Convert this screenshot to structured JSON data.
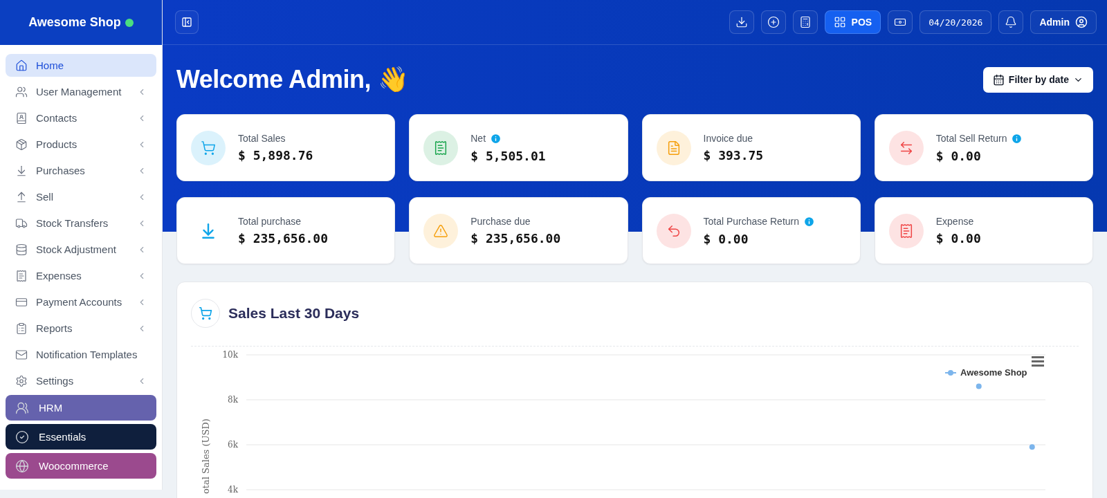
{
  "brand": {
    "name": "Awesome Shop",
    "online": true
  },
  "sidebar": {
    "items": [
      {
        "label": "Home",
        "selected": true,
        "submenu": false
      },
      {
        "label": "User Management",
        "selected": false,
        "submenu": true
      },
      {
        "label": "Contacts",
        "selected": false,
        "submenu": true
      },
      {
        "label": "Products",
        "selected": false,
        "submenu": true
      },
      {
        "label": "Purchases",
        "selected": false,
        "submenu": true
      },
      {
        "label": "Sell",
        "selected": false,
        "submenu": true
      },
      {
        "label": "Stock Transfers",
        "selected": false,
        "submenu": true
      },
      {
        "label": "Stock Adjustment",
        "selected": false,
        "submenu": true
      },
      {
        "label": "Expenses",
        "selected": false,
        "submenu": true
      },
      {
        "label": "Payment Accounts",
        "selected": false,
        "submenu": true
      },
      {
        "label": "Reports",
        "selected": false,
        "submenu": true
      },
      {
        "label": "Notification Templates",
        "selected": false,
        "submenu": false
      },
      {
        "label": "Settings",
        "selected": false,
        "submenu": true
      }
    ],
    "modules": [
      {
        "label": "HRM",
        "color": "#6562ad"
      },
      {
        "label": "Essentials",
        "color": "#0f1f3d"
      },
      {
        "label": "Woocommerce",
        "color": "#9b4a8e"
      }
    ]
  },
  "topbar": {
    "buttons": [
      {
        "kind": "icon"
      },
      {
        "kind": "icon"
      },
      {
        "kind": "icon"
      },
      {
        "kind": "pos",
        "label": "POS"
      },
      {
        "kind": "icon"
      },
      {
        "kind": "date",
        "label": "04/20/2026"
      },
      {
        "kind": "icon"
      },
      {
        "kind": "user",
        "label": "Admin"
      }
    ]
  },
  "welcome": {
    "title": "Welcome Admin,",
    "emoji": "👋",
    "filter": "Filter by date"
  },
  "stats": [
    {
      "label": "Total Sales",
      "value": "$ 5,898.76",
      "color": "#0ea5e9",
      "info": false
    },
    {
      "label": "Net",
      "value": "$ 5,505.01",
      "color": "#16a34a",
      "info": true
    },
    {
      "label": "Invoice due",
      "value": "$ 393.75",
      "color": "#f59e0b",
      "info": false
    },
    {
      "label": "Total Sell Return",
      "value": "$ 0.00",
      "color": "#ef4444",
      "info": true
    },
    {
      "label": "Total purchase",
      "value": "$ 235,656.00",
      "color": "#0ea5e9",
      "info": false
    },
    {
      "label": "Purchase due",
      "value": "$ 235,656.00",
      "color": "#f59e0b",
      "info": false
    },
    {
      "label": "Total Purchase Return",
      "value": "$ 0.00",
      "color": "#ef4444",
      "info": true
    },
    {
      "label": "Expense",
      "value": "$ 0.00",
      "color": "#ef4444",
      "info": false
    }
  ],
  "sales_panel": {
    "title": "Sales Last 30 Days",
    "chart_data": {
      "type": "line",
      "ylabel": "otal Sales (USD)",
      "grid": true,
      "ylim": [
        4000,
        10000
      ],
      "yticks": [
        {
          "value": 4000,
          "label": "4k"
        },
        {
          "value": 6000,
          "label": "6k"
        },
        {
          "value": 8000,
          "label": "8k"
        },
        {
          "value": 10000,
          "label": "10k"
        }
      ],
      "series": [
        {
          "name": "Awesome Shop",
          "color": "#7cb5ec",
          "marker": true,
          "values": [
            null,
            null,
            null,
            null,
            null,
            null,
            null,
            null,
            null,
            null,
            null,
            null,
            null,
            null,
            null,
            null,
            null,
            null,
            null,
            null,
            null,
            null,
            null,
            null,
            null,
            null,
            null,
            8600,
            null,
            5900
          ]
        }
      ]
    }
  }
}
